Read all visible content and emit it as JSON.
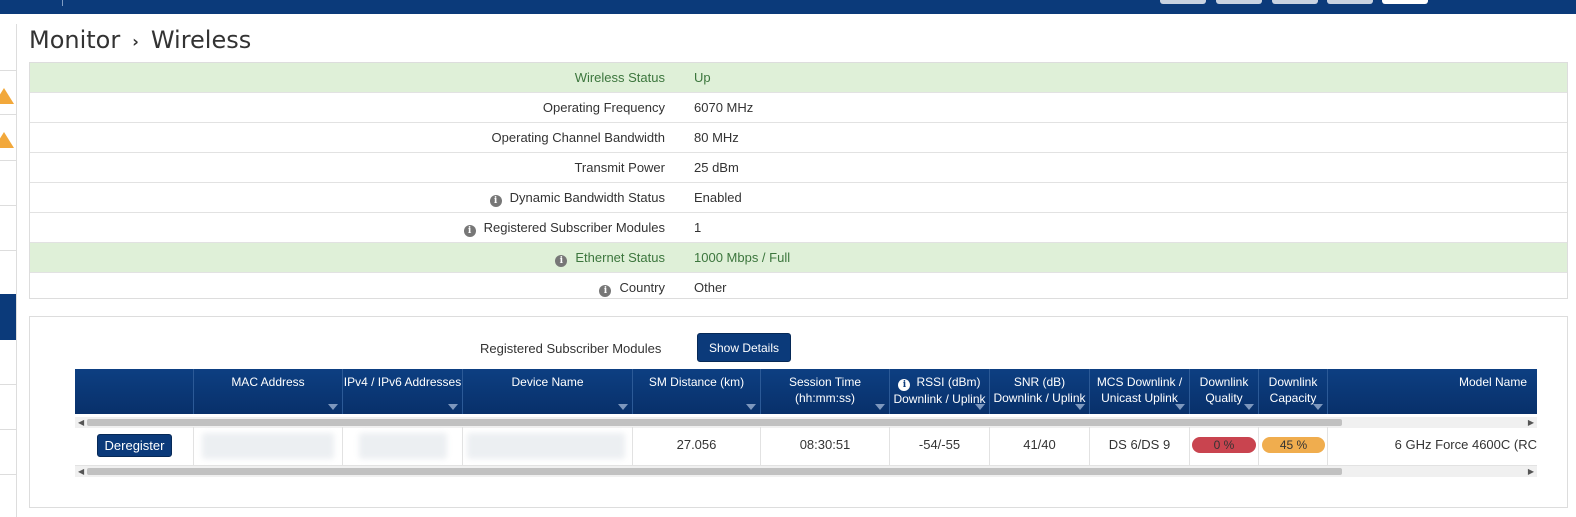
{
  "breadcrumb": {
    "parent": "Monitor",
    "separator": "›",
    "current": "Wireless"
  },
  "status_rows": [
    {
      "label": "Wireless Status",
      "value": "Up",
      "info": false,
      "highlight": true
    },
    {
      "label": "Operating Frequency",
      "value": "6070 MHz",
      "info": false,
      "highlight": false
    },
    {
      "label": "Operating Channel Bandwidth",
      "value": "80 MHz",
      "info": false,
      "highlight": false
    },
    {
      "label": "Transmit Power",
      "value": "25 dBm",
      "info": false,
      "highlight": false
    },
    {
      "label": "Dynamic Bandwidth Status",
      "value": "Enabled",
      "info": true,
      "highlight": false
    },
    {
      "label": "Registered Subscriber Modules",
      "value": "1",
      "info": true,
      "highlight": false
    },
    {
      "label": "Ethernet Status",
      "value": "1000 Mbps / Full",
      "info": true,
      "highlight": true
    },
    {
      "label": "Country",
      "value": "Other",
      "info": true,
      "highlight": false
    }
  ],
  "sm_section": {
    "label": "Registered Subscriber Modules",
    "show_details_label": "Show Details"
  },
  "table": {
    "columns": {
      "mac": "MAC Address",
      "ip": "IPv4 / IPv6 Addresses",
      "device": "Device Name",
      "distance": "SM Distance (km)",
      "session_1": "Session Time",
      "session_2": "(hh:mm:ss)",
      "rssi_1": "RSSI (dBm)",
      "rssi_2": "Downlink / Uplink",
      "snr_1": "SNR (dB)",
      "snr_2": "Downlink / Uplink",
      "mcs_1": "MCS Downlink /",
      "mcs_2": "Unicast Uplink",
      "quality_1": "Downlink",
      "quality_2": "Quality",
      "capacity_1": "Downlink",
      "capacity_2": "Capacity",
      "model": "Model Name"
    },
    "row": {
      "deregister_label": "Deregister",
      "distance": "27.056",
      "session_time": "08:30:51",
      "rssi": "-54/-55",
      "snr": "41/40",
      "mcs": "DS 6/DS 9",
      "quality": "0 %",
      "quality_value": 0,
      "capacity": "45 %",
      "capacity_value": 45,
      "model": "6 GHz Force 4600C (RC"
    }
  },
  "colors": {
    "header_bg": "#0b3a7a",
    "success_bg": "#dff0d8",
    "success_text": "#3c763d",
    "quality_pill": "#c9444f",
    "capacity_pill": "#f0ad4e",
    "warning": "#f2a83b"
  },
  "icons": {
    "info": "info-circle-icon",
    "sort": "sort-caret-icon",
    "warning": "warning-triangle-icon"
  }
}
